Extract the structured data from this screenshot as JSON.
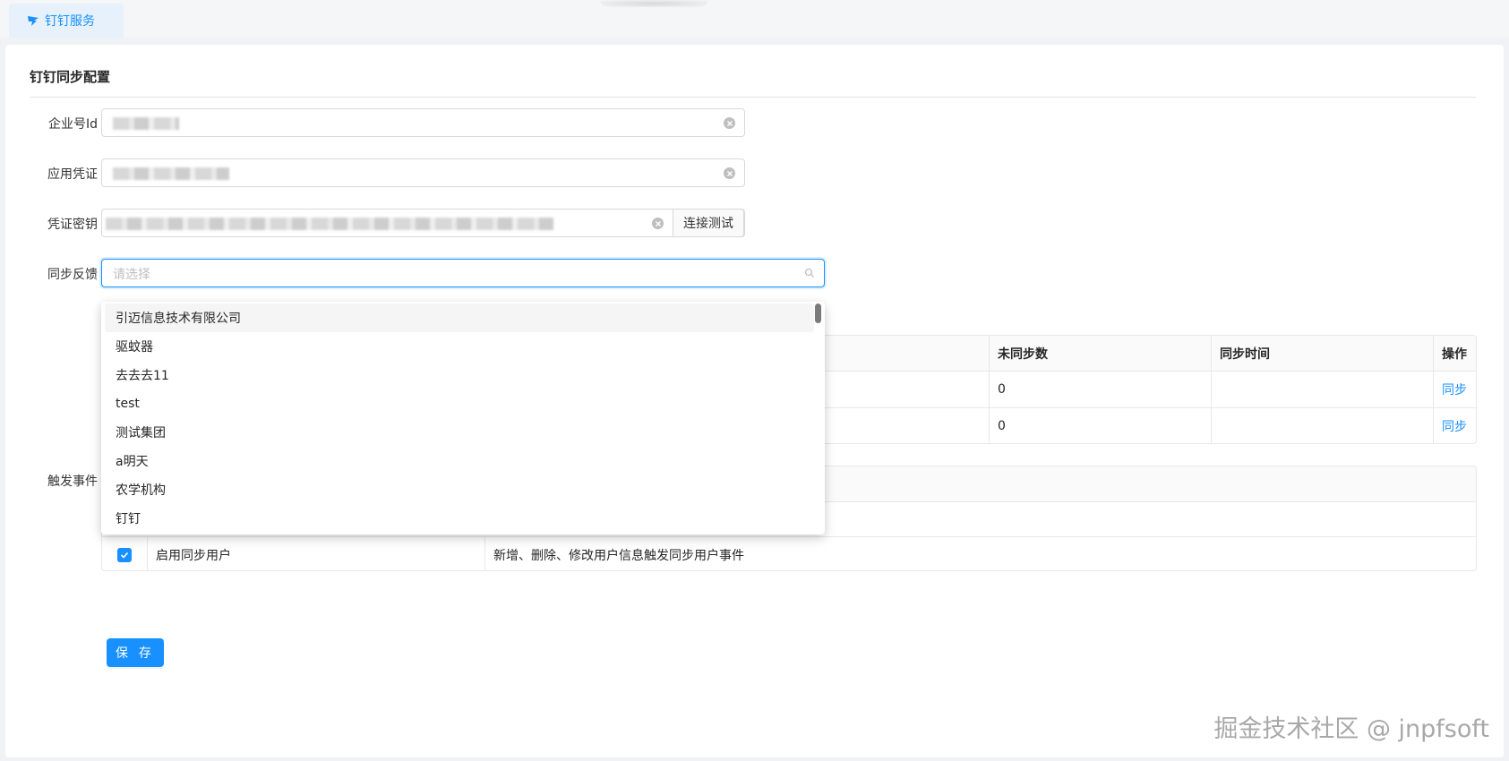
{
  "tab": {
    "label": "钉钉服务",
    "icon": "dingtalk-icon"
  },
  "section": {
    "title": "钉钉同步配置"
  },
  "form": {
    "corp_id_label": "企业号Id",
    "app_key_label": "应用凭证",
    "app_secret_label": "凭证密钥",
    "connect_test_label": "连接测试",
    "sync_feedback_label": "同步反馈",
    "sync_feedback_placeholder": "请选择",
    "trigger_event_label": "触发事件"
  },
  "sync_table": {
    "headers": {
      "unsynced": "未同步数",
      "sync_time": "同步时间",
      "action": "操作"
    },
    "rows": [
      {
        "unsynced": "0",
        "sync_time": "",
        "action": "同步"
      },
      {
        "unsynced": "0",
        "sync_time": "",
        "action": "同步"
      }
    ]
  },
  "event_table": {
    "rows": [
      {
        "checked": true,
        "name": "启用同步用户",
        "description": "新增、删除、修改用户信息触发同步用户事件"
      }
    ]
  },
  "save_label": "保 存",
  "dropdown": {
    "options": [
      "引迈信息技术有限公司",
      "驱蚊器",
      "去去去11",
      "test",
      "测试集团",
      "a明天",
      "农学机构",
      "钉钉"
    ]
  },
  "watermark": "掘金技术社区 @ jnpfsoft",
  "colors": {
    "primary": "#1890ff",
    "tab_bg": "#e6f1fb"
  }
}
